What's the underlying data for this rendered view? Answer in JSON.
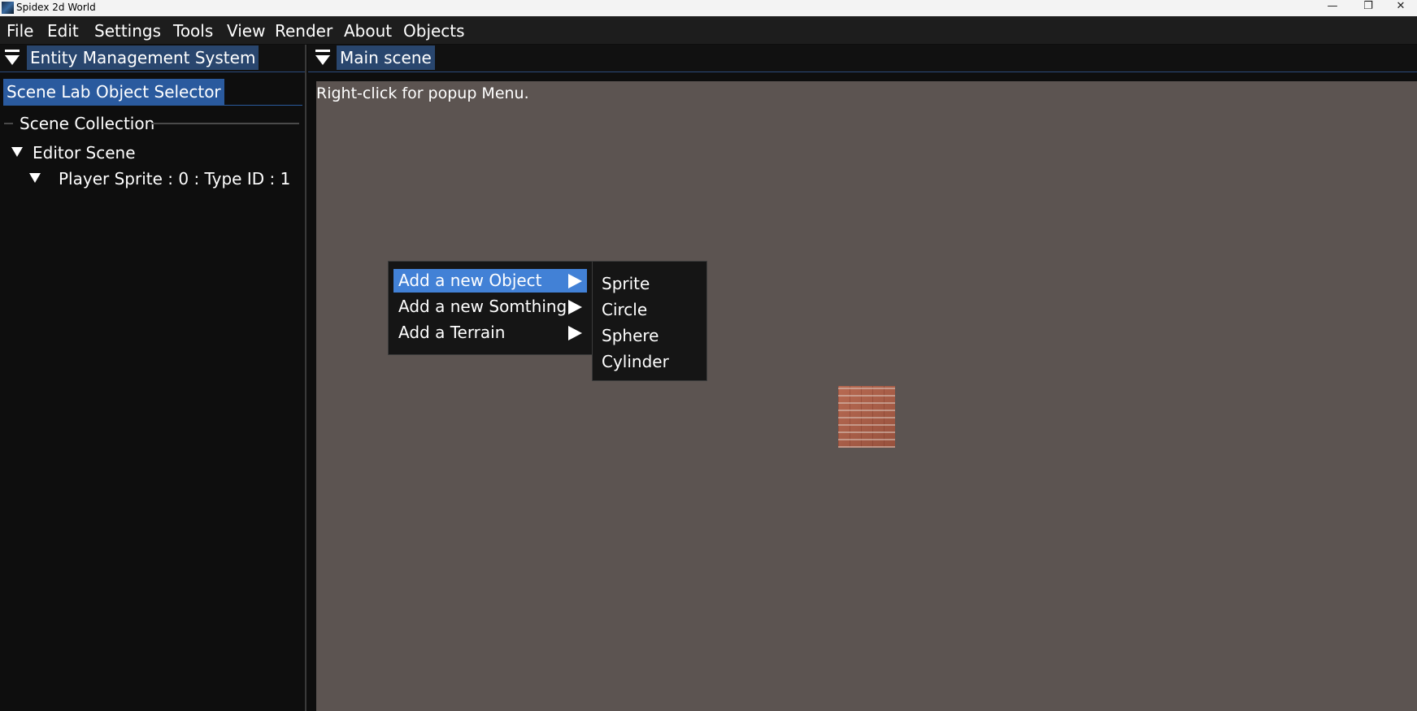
{
  "window": {
    "title": "Spidex 2d World",
    "controls": {
      "minimize": "—",
      "maximize": "❐",
      "close": "✕"
    }
  },
  "menubar": {
    "items": [
      "File",
      "Edit",
      "Settings",
      "Tools",
      "View",
      "Render",
      "About",
      "Objects"
    ]
  },
  "left_panel": {
    "title": "Entity Management System",
    "tabs": [
      "Scene Lab",
      "Object Selector"
    ],
    "section_label": "Scene Collection",
    "tree": {
      "root": "Editor Scene",
      "child": "Player Sprite : 0 : Type ID : 1"
    }
  },
  "main_panel": {
    "title": "Main scene",
    "hint": "Right-click for popup Menu."
  },
  "popup_menu": {
    "items": [
      "Add a new Object",
      "Add a new Somthing",
      "Add a Terrain"
    ],
    "highlighted_index": 0
  },
  "submenu": {
    "items": [
      "Sprite",
      "Circle",
      "Sphere",
      "Cylinder"
    ]
  },
  "colors": {
    "menubar_bg": "#1d1d1d",
    "panel_title_bg": "#29466e",
    "tab_bg": "#2a5a9e",
    "viewport_bg": "#5c5451",
    "highlight": "#4281d6"
  }
}
